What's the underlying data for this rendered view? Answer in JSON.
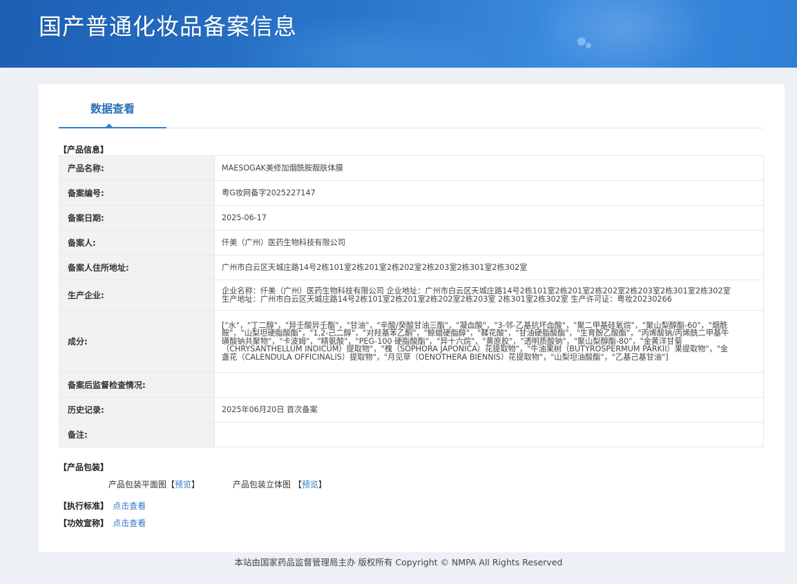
{
  "header": {
    "title": "国产普通化妆品备案信息"
  },
  "tabs": [
    {
      "label": "数据查看",
      "active": true
    }
  ],
  "product_info": {
    "section_label": "【产品信息】",
    "rows": [
      {
        "label": "产品名称:",
        "value": "MAESOGAK美修加烟酰胺靓肤体膜"
      },
      {
        "label": "备案编号:",
        "value": "粤G妆网备字2025227147"
      },
      {
        "label": "备案日期:",
        "value": "2025-06-17"
      },
      {
        "label": "备案人:",
        "value": "仟美（广州）医药生物科技有限公司"
      },
      {
        "label": "备案人住所地址:",
        "value": "广州市白云区天城庄路14号2栋101室2栋201室2栋202室2栋203室2栋301室2栋302室"
      },
      {
        "label": "生产企业:",
        "value": "企业名称：仟美（广州）医药生物科技有限公司 企业地址：广州市白云区天城庄路14号2栋101室2栋201室2栋202室2栋203室2栋301室2栋302室 生产地址：广州市白云区天城庄路14号2栋101室2栋201室2栋202室2栋203室 2栋301室2栋302室 生产许可证：粤妆20230266"
      },
      {
        "label": "成分:",
        "value": "[\"水\"，\"丁二醇\"，\"异壬酸异壬酯\"，\"甘油\"，\"辛酸/癸酸甘油三酯\"，\"凝血酸\"，\"3-邻-乙基抗坏血酸\"，\"聚二甲基硅氧烷\"，\"聚山梨醇酯-60\"，\"烟酰胺\"，\"山梨坦硬脂酸酯\"，\"1,2-己二醇\"，\"对羟基苯乙酮\"，\"鲸蜡硬脂醇\"，\"鞣花酸\"，\"甘油硬脂酸酯\"，\"生育酚乙酸酯\"，\"丙烯酸钠/丙烯酰二甲基牛磺酸钠共聚物\"，\"卡波姆\"，\"精氨酸\"，\"PEG-100 硬脂酸酯\"，\"异十六烷\"，\"黄原胶\"，\"透明质酸钠\"，\"聚山梨醇酯-80\"，\"金黄洋甘菊（CHRYSANTHELLUM INDICUM）提取物\"，\"槐（SOPHORA JAPONICA）花提取物\"，\"牛油果树（BUTYROSPERMUM PARKII）果提取物\"，\"金盏花（CALENDULA OFFICINALIS）提取物\"，\"月见草（OENOTHERA BIENNIS）花提取物\"，\"山梨坦油酸酯\"，\"乙基己基甘油\"]"
      },
      {
        "label": "备案后监督检查情况:",
        "value": ""
      },
      {
        "label": "历史记录:",
        "value": "2025年06月20日 首次备案"
      },
      {
        "label": "备注:",
        "value": ""
      }
    ]
  },
  "packaging": {
    "section_label": "【产品包装】",
    "flat_label": "产品包装平面图",
    "stereo_label": "产品包装立体图",
    "bracket_open": "【",
    "bracket_close": "】",
    "preview_label": "预览"
  },
  "standard": {
    "section_label": "【执行标准】",
    "link_label": "点击查看"
  },
  "efficacy": {
    "section_label": "【功效宣称】",
    "link_label": "点击查看"
  },
  "footer": {
    "text": "本站由国家药品监督管理局主办 版权所有 Copyright © NMPA All Rights Reserved"
  },
  "colors": {
    "banner": "#2a76cc",
    "tab_active": "#2a6fb6",
    "link": "#2e7bc4",
    "label_bg": "#f2f2f2",
    "page_bg": "#edf0f4"
  }
}
